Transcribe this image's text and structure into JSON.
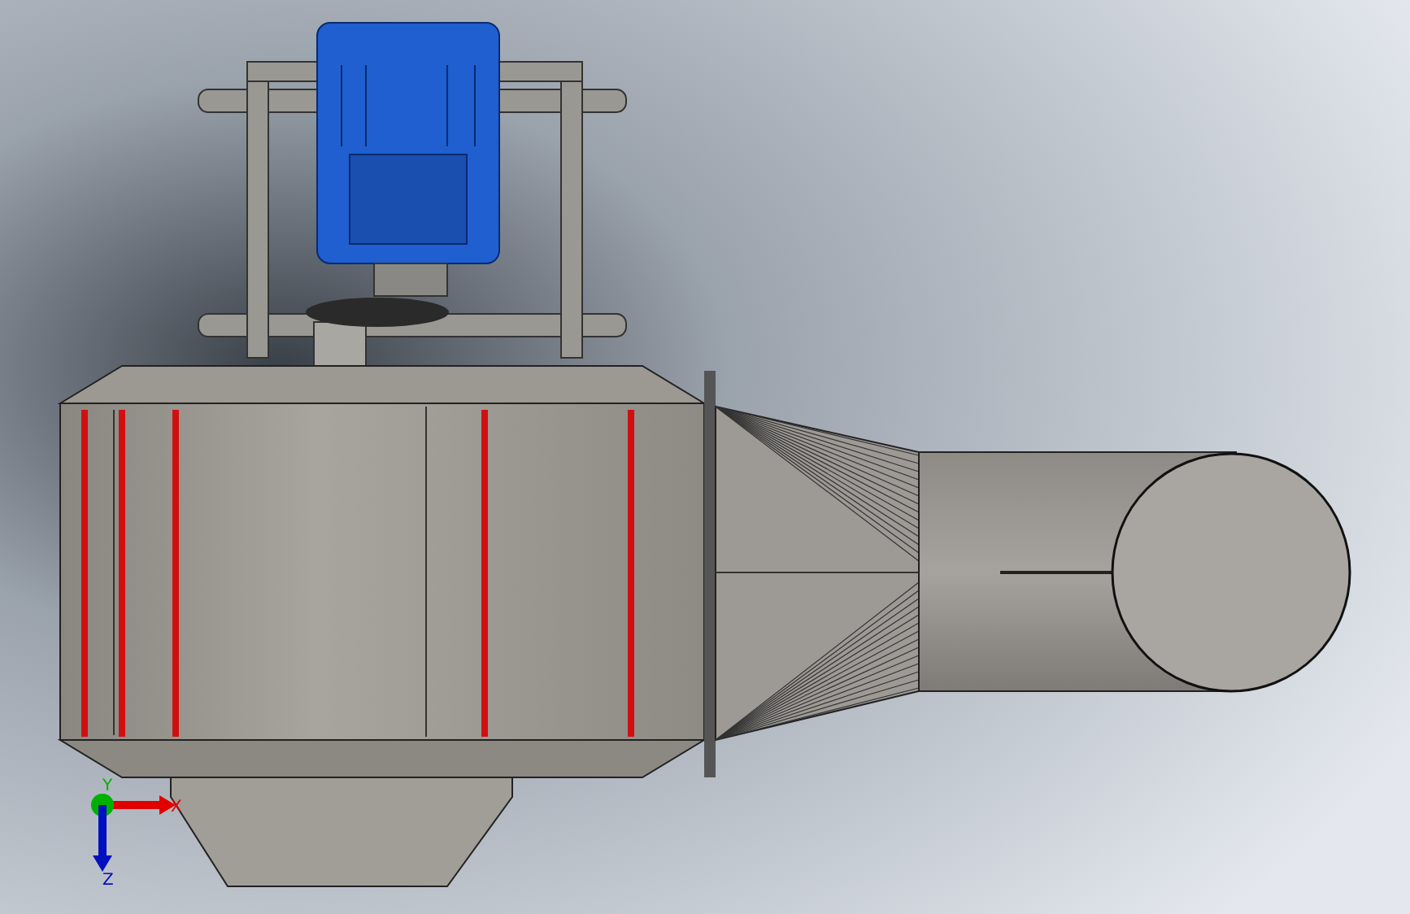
{
  "viewport": {
    "triad": {
      "axes": [
        {
          "kind": "x",
          "label": "X",
          "color": "#e00000"
        },
        {
          "kind": "y",
          "label": "Y",
          "color": "#00b000"
        },
        {
          "kind": "z",
          "label": "Z",
          "color": "#0010c0"
        }
      ]
    }
  }
}
